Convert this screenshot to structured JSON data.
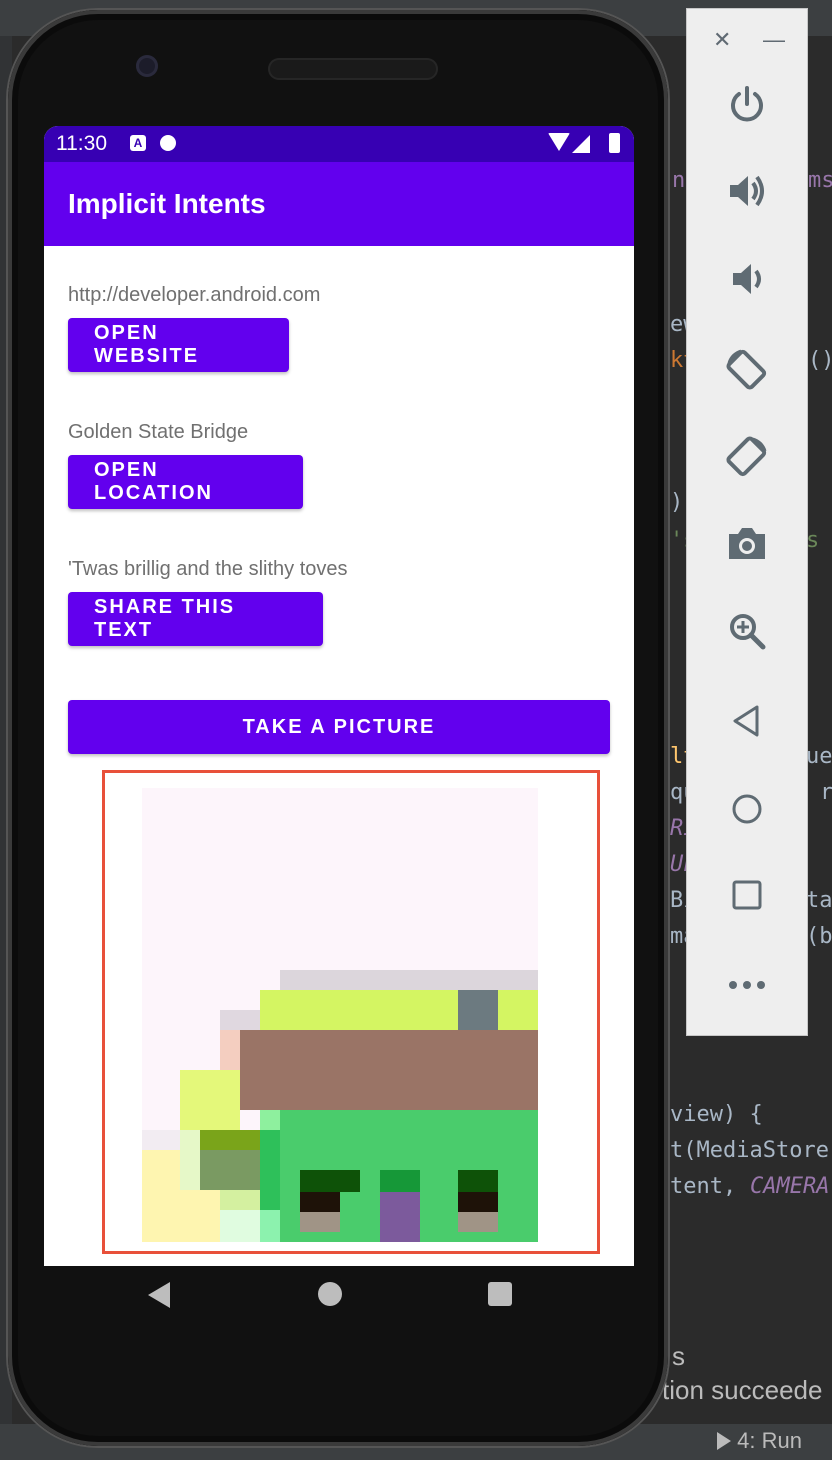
{
  "ide": {
    "code_fragments": [
      "nt",
      "ms",
      "ew",
      "kt",
      "()",
      ")",
      "'s",
      "s",
      "lt",
      "ue",
      "qu",
      "r",
      "RI",
      "UL",
      "Bi",
      "ta",
      "ma",
      "(b",
      "view) {",
      "t(MediaStore",
      "tent, ",
      "CAMERA"
    ],
    "console_lines": [
      "s",
      "tion succeede"
    ],
    "run_label": "4: Run"
  },
  "phone": {
    "status_bar": {
      "time": "11:30",
      "a_badge": "A"
    },
    "app_bar": {
      "title": "Implicit Intents"
    },
    "website": {
      "text": "http://developer.android.com",
      "button": "OPEN WEBSITE"
    },
    "location": {
      "text": "Golden State Bridge",
      "button": "OPEN LOCATION"
    },
    "share": {
      "text": "'Twas brillig and the slithy toves",
      "button": "SHARE THIS TEXT"
    },
    "camera": {
      "button": "TAKE A PICTURE"
    }
  },
  "emulator_panel": {
    "close": "✕",
    "minimize": "—",
    "buttons": [
      "power-icon",
      "volume-up-icon",
      "volume-down-icon",
      "rotate-left-icon",
      "rotate-right-icon",
      "camera-icon",
      "zoom-icon",
      "back-icon",
      "home-icon",
      "overview-icon",
      "more-icon"
    ]
  },
  "colors": {
    "primary": "#6200ee",
    "primary_dark": "#3700b3",
    "frame": "#e8503a"
  }
}
